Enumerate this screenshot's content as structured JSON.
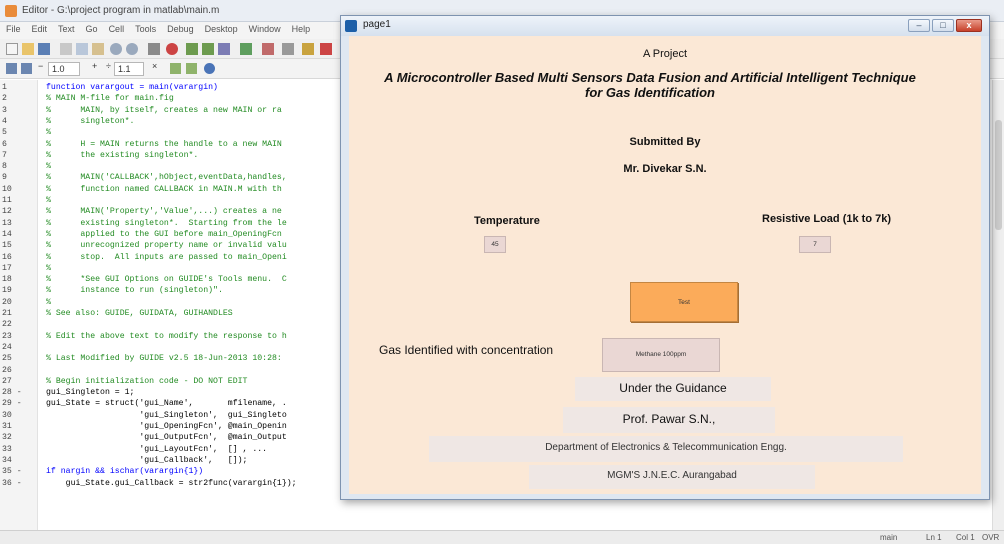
{
  "editor": {
    "title": "Editor - G:\\project program in matlab\\main.m",
    "menu": [
      "File",
      "Edit",
      "Text",
      "Go",
      "Cell",
      "Tools",
      "Debug",
      "Desktop",
      "Window",
      "Help"
    ],
    "cellbar": {
      "value1": "1.0",
      "plus": "+",
      "divide": "÷",
      "value2": "1.1",
      "times": "×"
    },
    "code_lines": [
      {
        "n": "1",
        "t": "function varargout = main(varargin)",
        "k": "kw"
      },
      {
        "n": "2",
        "t": "% MAIN M-file for main.fig",
        "k": "comment"
      },
      {
        "n": "3",
        "t": "%      MAIN, by itself, creates a new MAIN or ra",
        "k": "comment"
      },
      {
        "n": "4",
        "t": "%      singleton*.",
        "k": "comment"
      },
      {
        "n": "5",
        "t": "%",
        "k": "comment"
      },
      {
        "n": "6",
        "t": "%      H = MAIN returns the handle to a new MAIN",
        "k": "comment"
      },
      {
        "n": "7",
        "t": "%      the existing singleton*.",
        "k": "comment"
      },
      {
        "n": "8",
        "t": "%",
        "k": "comment"
      },
      {
        "n": "9",
        "t": "%      MAIN('CALLBACK',hObject,eventData,handles,",
        "k": "comment"
      },
      {
        "n": "10",
        "t": "%      function named CALLBACK in MAIN.M with th",
        "k": "comment"
      },
      {
        "n": "11",
        "t": "%",
        "k": "comment"
      },
      {
        "n": "12",
        "t": "%      MAIN('Property','Value',...) creates a ne",
        "k": "comment"
      },
      {
        "n": "13",
        "t": "%      existing singleton*.  Starting from the le",
        "k": "comment"
      },
      {
        "n": "14",
        "t": "%      applied to the GUI before main_OpeningFcn",
        "k": "comment"
      },
      {
        "n": "15",
        "t": "%      unrecognized property name or invalid valu",
        "k": "comment"
      },
      {
        "n": "16",
        "t": "%      stop.  All inputs are passed to main_Openi",
        "k": "comment"
      },
      {
        "n": "17",
        "t": "%",
        "k": "comment"
      },
      {
        "n": "18",
        "t": "%      *See GUI Options on GUIDE's Tools menu.  C",
        "k": "comment"
      },
      {
        "n": "19",
        "t": "%      instance to run (singleton)\".",
        "k": "comment"
      },
      {
        "n": "20",
        "t": "%",
        "k": "comment"
      },
      {
        "n": "21",
        "t": "% See also: GUIDE, GUIDATA, GUIHANDLES",
        "k": "comment"
      },
      {
        "n": "22",
        "t": "",
        "k": "code"
      },
      {
        "n": "23",
        "t": "% Edit the above text to modify the response to h",
        "k": "comment"
      },
      {
        "n": "24",
        "t": "",
        "k": "code"
      },
      {
        "n": "25",
        "t": "% Last Modified by GUIDE v2.5 18-Jun-2013 10:28:",
        "k": "comment"
      },
      {
        "n": "26",
        "t": "",
        "k": "code"
      },
      {
        "n": "27",
        "t": "% Begin initialization code - DO NOT EDIT",
        "k": "comment"
      },
      {
        "n": "28 -",
        "t": "gui_Singleton = 1;",
        "k": "code"
      },
      {
        "n": "29 -",
        "t": "gui_State = struct('gui_Name',       mfilename, .",
        "k": "code"
      },
      {
        "n": "30",
        "t": "                   'gui_Singleton',  gui_Singleto",
        "k": "code"
      },
      {
        "n": "31",
        "t": "                   'gui_OpeningFcn', @main_Openin",
        "k": "code"
      },
      {
        "n": "32",
        "t": "                   'gui_OutputFcn',  @main_Output",
        "k": "code"
      },
      {
        "n": "33",
        "t": "                   'gui_LayoutFcn',  [] , ...",
        "k": "code"
      },
      {
        "n": "34",
        "t": "                   'gui_Callback',   []);",
        "k": "code"
      },
      {
        "n": "35 -",
        "t": "if nargin && ischar(varargin{1})",
        "k": "kw"
      },
      {
        "n": "36 -",
        "t": "    gui_State.gui_Callback = str2func(varargin{1});",
        "k": "code"
      }
    ],
    "status": {
      "mode": "main",
      "ln": "Ln 1",
      "col": "Col 1",
      "ovr": "OVR"
    }
  },
  "figure": {
    "window_title": "page1",
    "minimize": "–",
    "maximize": "□",
    "close": "x",
    "heading": "A Project",
    "project_title": "A Microcontroller Based Multi Sensors Data Fusion and Artificial Intelligent Technique for Gas Identification",
    "submitted_by": "Submitted By",
    "author": "Mr. Divekar S.N.",
    "temperature_label": "Temperature",
    "temperature_value": "45",
    "load_label": "Resistive Load (1k to 7k)",
    "load_value": "7",
    "test_button": "Test",
    "gas_label": "Gas Identified with concentration",
    "gas_result": "Methane 100ppm",
    "guidance": "Under the Guidance",
    "guide_name": "Prof. Pawar S.N.,",
    "department": "Department of Electronics & Telecommunication Engg.",
    "college": "MGM'S J.N.E.C. Aurangabad"
  },
  "colors": {
    "figure_bg": "#fbe8d6",
    "button": "#fbab5a",
    "edit_box": "#ead7d4",
    "comment": "#228b22"
  }
}
